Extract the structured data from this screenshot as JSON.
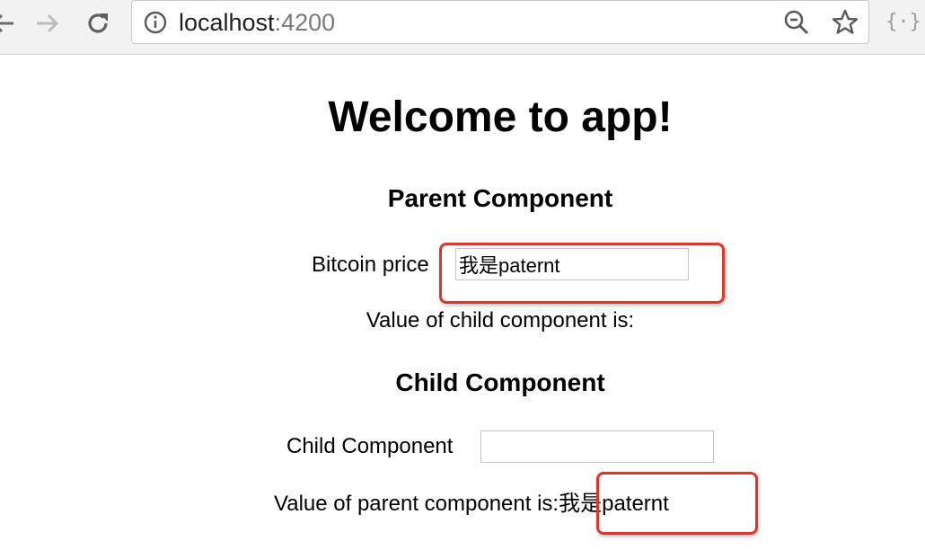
{
  "browser": {
    "url_host": "localhost",
    "url_port": ":4200",
    "icons": [
      "back-icon",
      "forward-icon",
      "reload-icon",
      "info-icon",
      "zoom-icon",
      "star-icon",
      "extension-icon"
    ],
    "extension_label": "{·}"
  },
  "page": {
    "title": "Welcome to app!",
    "parent": {
      "heading": "Parent Component",
      "bitcoin_label": "Bitcoin price",
      "bitcoin_value": "我是paternt",
      "child_value_label": "Value of child component is:",
      "child_value": ""
    },
    "child": {
      "heading": "Child Component",
      "input_label": "Child Component",
      "input_value": "",
      "parent_value_label": "Value of parent component is:",
      "parent_value": "我是paternt"
    }
  },
  "colors": {
    "highlight": "#e0352b",
    "chrome_bg": "#f2f2f2"
  }
}
